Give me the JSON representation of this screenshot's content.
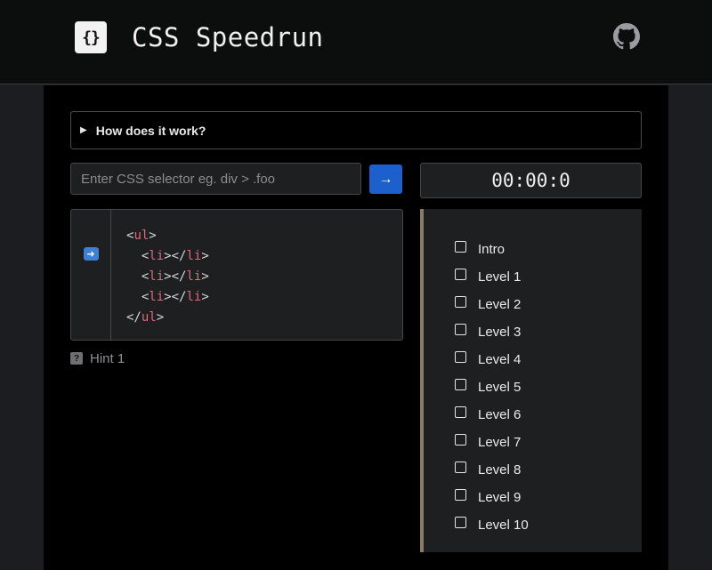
{
  "header": {
    "logo_glyph": "{}",
    "title": "CSS Speedrun",
    "github_icon": "github-icon"
  },
  "details": {
    "summary": "How does it work?",
    "expanded": false
  },
  "selector": {
    "placeholder": "Enter CSS selector eg. div > .foo",
    "value": ""
  },
  "go_button": {
    "label": "→",
    "color": "#1d5fcc"
  },
  "timer": {
    "value": "00:00:0"
  },
  "code": {
    "lines": [
      {
        "indent": "",
        "open": "ul",
        "close": null,
        "selfclose": false,
        "text": "<ul>"
      },
      {
        "indent": "  ",
        "open": "li",
        "close": "li",
        "text": "<li></li>"
      },
      {
        "indent": "  ",
        "open": "li",
        "close": "li",
        "text": "<li></li>"
      },
      {
        "indent": "  ",
        "open": "li",
        "close": "li",
        "text": "<li></li>"
      },
      {
        "indent": "",
        "open": null,
        "close": "ul",
        "text": "</ul>"
      }
    ]
  },
  "run_button": {
    "icon": "arrow-right-icon"
  },
  "hint": {
    "label": "Hint 1",
    "icon": "question-icon"
  },
  "levels": {
    "items": [
      {
        "label": "Intro",
        "checked": false
      },
      {
        "label": "Level 1",
        "checked": false
      },
      {
        "label": "Level 2",
        "checked": false
      },
      {
        "label": "Level 3",
        "checked": false
      },
      {
        "label": "Level 4",
        "checked": false
      },
      {
        "label": "Level 5",
        "checked": false
      },
      {
        "label": "Level 6",
        "checked": false
      },
      {
        "label": "Level 7",
        "checked": false
      },
      {
        "label": "Level 8",
        "checked": false
      },
      {
        "label": "Level 9",
        "checked": false
      },
      {
        "label": "Level 10",
        "checked": false
      }
    ]
  },
  "colors": {
    "accent_blue": "#1d5fcc",
    "tag_red": "#e0697a",
    "level_border": "#8a7b63"
  }
}
